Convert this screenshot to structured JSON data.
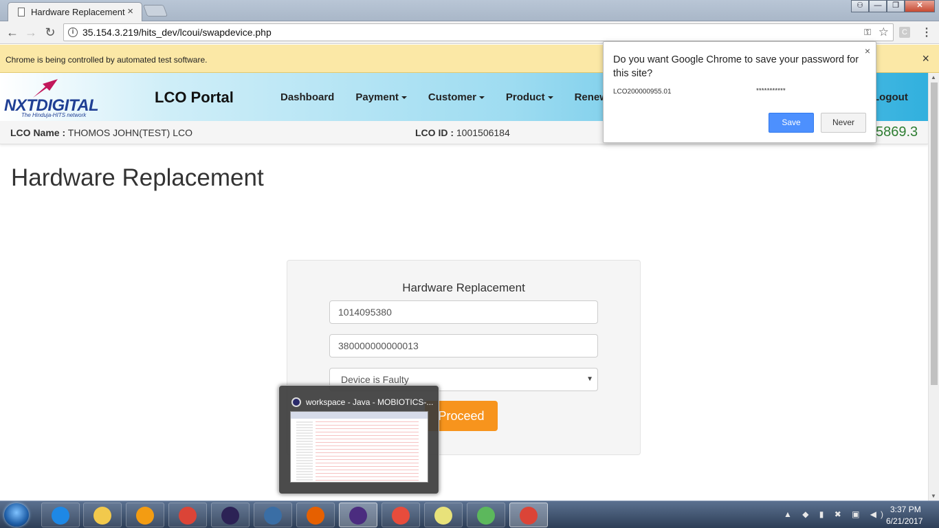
{
  "browser": {
    "tab_title": "Hardware Replacement",
    "tab_close": "×",
    "url": "35.154.3.219/hits_dev/lcoui/swapdevice.php",
    "infobar_text": "Chrome is being controlled by automated test software.",
    "infobar_close": "×",
    "nav": {
      "back": "←",
      "forward": "→",
      "reload": "↻"
    },
    "window_controls": {
      "help": "?",
      "minimize": "—",
      "restore": "❐",
      "close": "✕"
    }
  },
  "site": {
    "logo_text": "NXTDIGITAL",
    "logo_tagline": "The Hinduja-HITS network",
    "portal_title": "LCO Portal",
    "nav": [
      {
        "label": "Dashboard",
        "dropdown": false
      },
      {
        "label": "Payment",
        "dropdown": true
      },
      {
        "label": "Customer",
        "dropdown": true
      },
      {
        "label": "Product",
        "dropdown": true
      },
      {
        "label": "Renew",
        "dropdown": true
      }
    ],
    "logout": "Logout",
    "lco_name_label": "LCO Name :",
    "lco_name_value": "THOMOS JOHN(TEST) LCO",
    "lco_id_label": "LCO ID :",
    "lco_id_value": "1001506184",
    "balance": "5869.3"
  },
  "main": {
    "page_title": "Hardware Replacement",
    "panel_title": "Hardware Replacement",
    "field1_value": "1014095380",
    "field2_value": "380000000000013",
    "reason_selected": "Device is Faulty",
    "proceed_label": "Proceed"
  },
  "password_bubble": {
    "question": "Do you want Google Chrome to save your password for this site?",
    "username": "LCO200000955.01",
    "password": "***********",
    "save_label": "Save",
    "never_label": "Never",
    "close": "×"
  },
  "taskbar": {
    "thumbnail_title": "workspace - Java - MOBIOTICS-...",
    "clock_time": "3:37 PM",
    "clock_date": "6/21/2017",
    "apps": [
      {
        "name": "internet-explorer-icon",
        "color": "#1e88e5"
      },
      {
        "name": "file-explorer-icon",
        "color": "#f2c94c"
      },
      {
        "name": "media-player-icon",
        "color": "#f39c12"
      },
      {
        "name": "chrome-icon",
        "color": "#db4437"
      },
      {
        "name": "eclipse-icon",
        "color": "#2c2255"
      },
      {
        "name": "mysql-workbench-icon",
        "color": "#3a6ea5"
      },
      {
        "name": "firefox-icon",
        "color": "#e66000"
      },
      {
        "name": "java-ee-ide-icon",
        "color": "#4b2c7f"
      },
      {
        "name": "tool-icon",
        "color": "#e74c3c"
      },
      {
        "name": "sticky-notes-icon",
        "color": "#e8e27a"
      },
      {
        "name": "utorrent-icon",
        "color": "#5cb85c"
      },
      {
        "name": "chrome-active-icon",
        "color": "#db4437"
      }
    ]
  }
}
